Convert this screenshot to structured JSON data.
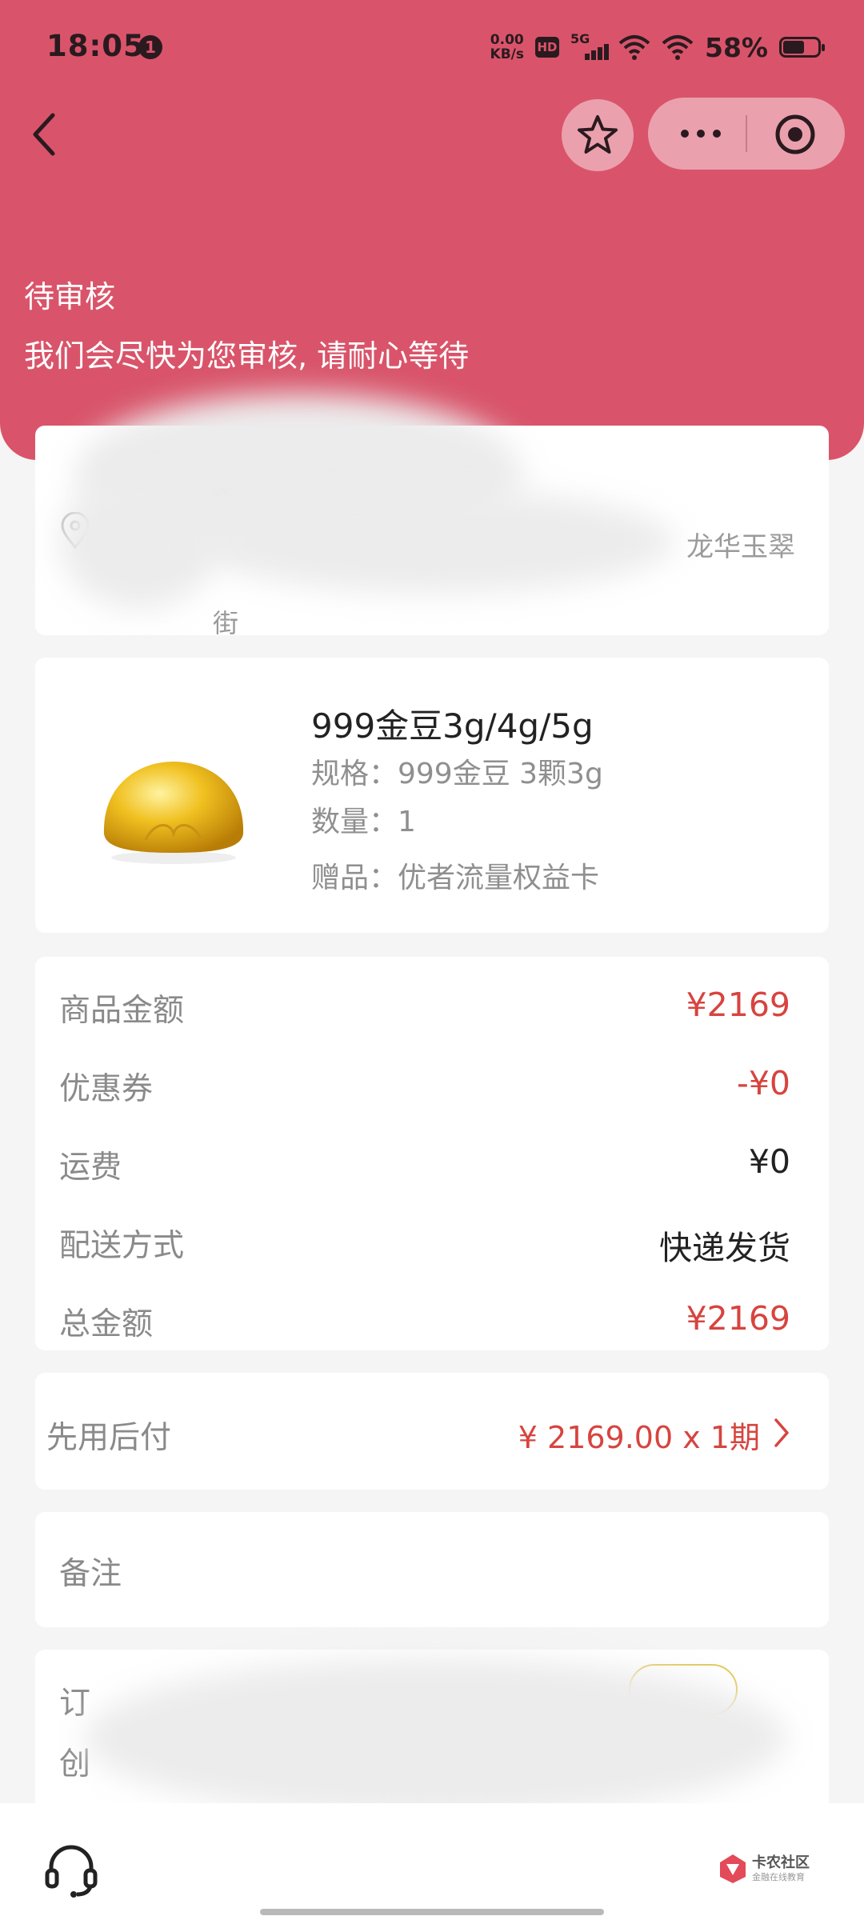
{
  "status_bar": {
    "time": "18:05",
    "notification_count": "1",
    "net_speed_value": "0.00",
    "net_speed_unit": "KB/s",
    "hd_label": "HD",
    "network_label": "5G",
    "battery": "58%"
  },
  "header": {
    "status_title": "待审核",
    "status_subtitle": "我们会尽快为您审核, 请耐心等待"
  },
  "address": {
    "line1_visible": "龙华玉翠",
    "line2_visible": "街"
  },
  "product": {
    "name": "999金豆3g/4g/5g",
    "spec": "规格：999金豆 3颗3g",
    "quantity": "数量：1",
    "gift": "赠品：优者流量权益卡"
  },
  "price_summary": [
    {
      "label": "商品金额",
      "value": "¥2169",
      "color": "#d7443f"
    },
    {
      "label": "优惠券",
      "value": "-¥0",
      "color": "#d7443f"
    },
    {
      "label": "运费",
      "value": "¥0",
      "color": "#222222"
    },
    {
      "label": "配送方式",
      "value": "快递发货",
      "color": "#222222"
    },
    {
      "label": "总金额",
      "value": "¥2169",
      "color": "#d7443f"
    }
  ],
  "payment": {
    "label": "先用后付",
    "value": "¥ 2169.00 x 1期"
  },
  "remark": {
    "label": "备注"
  },
  "order_info": {
    "label1_visible": "订",
    "label2_visible": "创"
  },
  "watermark": {
    "text1": "卡农社区",
    "text2": "金融在线教育"
  },
  "colors": {
    "header_bg": "#d9546a",
    "price_red": "#d7443f",
    "page_bg": "#f5f5f5"
  },
  "icons": [
    "back-icon",
    "star-icon",
    "more-icon",
    "target-icon",
    "location-pin-icon",
    "chevron-right-icon",
    "headset-icon"
  ]
}
